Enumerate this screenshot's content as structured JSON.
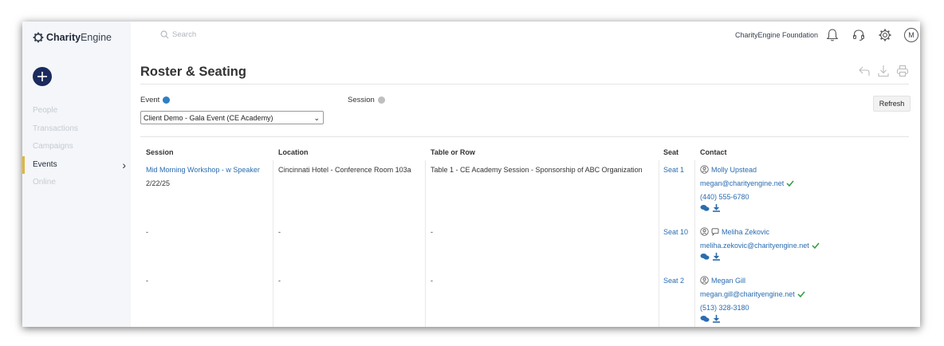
{
  "brand": {
    "name_bold": "Charity",
    "name_rest": "Engine"
  },
  "sidebar": {
    "items": [
      {
        "label": "People",
        "active": false
      },
      {
        "label": "Transactions",
        "active": false
      },
      {
        "label": "Campaigns",
        "active": false
      },
      {
        "label": "Events",
        "active": true
      },
      {
        "label": "Online",
        "active": false
      }
    ]
  },
  "topbar": {
    "search_placeholder": "Search",
    "org_name": "CharityEngine Foundation",
    "avatar_initial": "M"
  },
  "page": {
    "title": "Roster & Seating",
    "event_label": "Event",
    "session_label": "Session",
    "event_selected": "Client Demo - Gala Event (CE Academy)",
    "refresh_label": "Refresh"
  },
  "colors": {
    "event_dot": "#2f7fc1",
    "session_dot": "#bfbfbf",
    "link": "#2a6cb0",
    "verified": "#2e9c3e",
    "active_bar": "#e0b63a",
    "add_button": "#1a2a5e"
  },
  "table": {
    "headers": {
      "session": "Session",
      "location": "Location",
      "table_row": "Table or Row",
      "seat": "Seat",
      "contact": "Contact"
    },
    "rows": [
      {
        "session": "Mid Morning Workshop - w Speaker",
        "session_date": "2/22/25",
        "location": "Cincinnati Hotel - Conference Room 103a",
        "table_row": "Table 1 - CE Academy Session - Sponsorship of ABC Organization",
        "seat": "Seat 1",
        "contact_name": "Molly Upstead",
        "contact_email": "megan@charityengine.net",
        "contact_phone": "(440) 555-6780"
      },
      {
        "session": "-",
        "location": "-",
        "table_row": "-",
        "seat": "Seat 10",
        "contact_name": "Meliha Zekovic",
        "contact_email": "meliha.zekovic@charityengine.net"
      },
      {
        "session": "-",
        "location": "-",
        "table_row": "-",
        "seat": "Seat 2",
        "contact_name": "Megan Gill",
        "contact_email": "megan.gill@charityengine.net",
        "contact_phone": "(513) 328-3180"
      }
    ]
  }
}
